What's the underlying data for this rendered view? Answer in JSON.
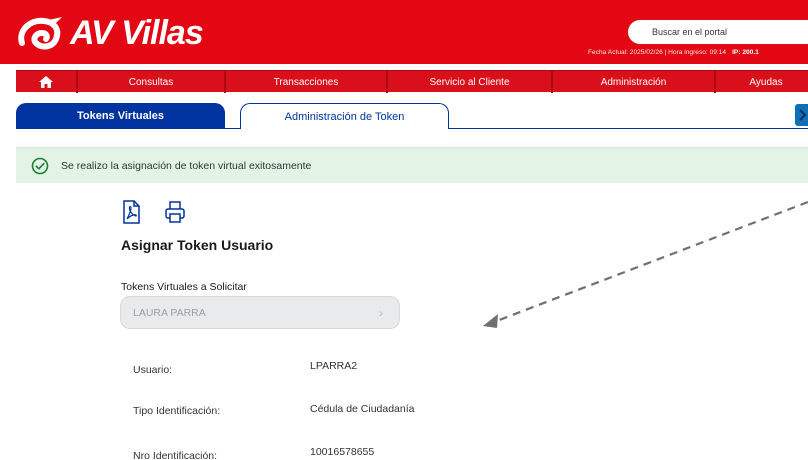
{
  "header": {
    "brand": "AV Villas",
    "search_placeholder": "Buscar en el portal",
    "session_info": "Fecha Actual: 2025/02/26 | Hora ingreso: 09:14",
    "ip_label": "IP: 200.1",
    "brand_color": "#e30613"
  },
  "nav": {
    "home_icon": "home-icon",
    "items": [
      "Consultas",
      "Transacciones",
      "Servicio al Cliente",
      "Administración",
      "Ayudas"
    ]
  },
  "tabs": {
    "active": "Tokens Virtuales",
    "inactive": "Administración de Token"
  },
  "alert": {
    "icon": "check-circle-icon",
    "message": "Se realizo la asignación de token virtual exitosamente"
  },
  "form": {
    "icons": [
      "pdf-icon",
      "print-icon"
    ],
    "title": "Asignar Token Usuario",
    "select_label": "Tokens Virtuales a Solicitar",
    "select_value": "LAURA PARRA",
    "details": [
      {
        "label": "Usuario:",
        "value": "LPARRA2"
      },
      {
        "label": "Tipo Identificación:",
        "value": "Cédula de Ciudadanía"
      },
      {
        "label": "Nro Identificación:",
        "value": "10016578655"
      }
    ]
  }
}
